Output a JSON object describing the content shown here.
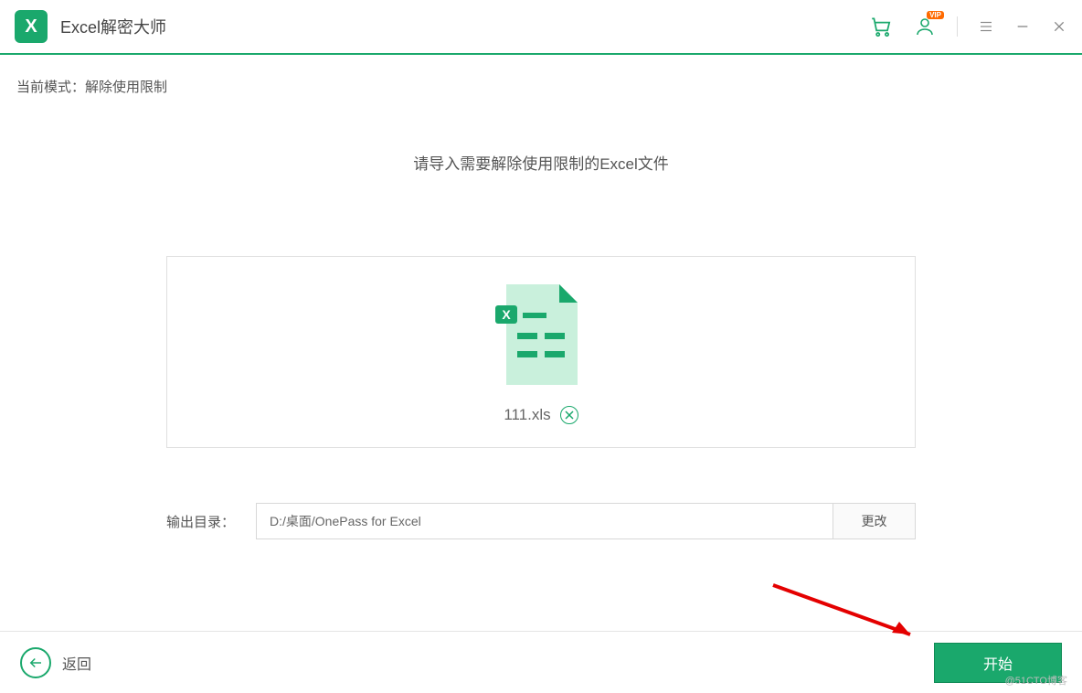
{
  "header": {
    "logo_letter": "X",
    "title": "Excel解密大师",
    "vip_badge": "VIP"
  },
  "mode": {
    "label": "当前模式：",
    "value": "解除使用限制"
  },
  "instruction": "请导入需要解除使用限制的Excel文件",
  "file": {
    "name": "111.xls"
  },
  "output": {
    "label": "输出目录：",
    "path": "D:/桌面/OnePass for Excel",
    "change": "更改"
  },
  "footer": {
    "back": "返回",
    "start": "开始"
  },
  "watermark": "@51CTO博客"
}
